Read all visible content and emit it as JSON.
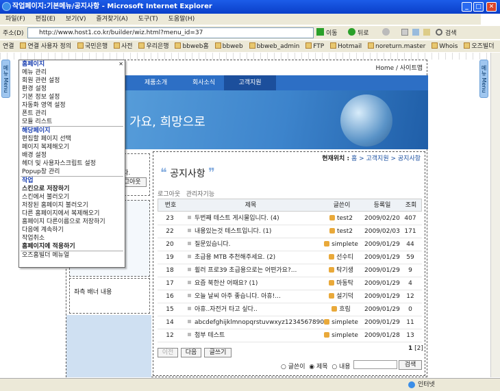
{
  "window": {
    "title": "작업페이지:기본메뉴/공지사항 - Microsoft Internet Explorer",
    "min": "_",
    "max": "□",
    "close": "✕"
  },
  "menubar": [
    "파일(F)",
    "편집(E)",
    "보기(V)",
    "즐겨찾기(A)",
    "도구(T)",
    "도움말(H)"
  ],
  "address": {
    "label": "주소(D)",
    "url": "http://www.host1.co.kr/builder/wiz.html?menu_id=37",
    "go": "이동",
    "back": "뒤로",
    "search": "검색"
  },
  "links": {
    "label": "연결",
    "items": [
      "연결 사용자 정의",
      "국민은행",
      "사전",
      "우리은행",
      "bbweb홈",
      "bbweb",
      "bbweb_admin",
      "FTP",
      "Hotmail",
      "noreturn.master",
      "Whois",
      "오즈빌더"
    ]
  },
  "page": {
    "breadcrumb_top": "Home / 사이트맵",
    "nav": [
      "제품소개",
      "회사소식",
      "고객지원"
    ],
    "banner_text": "가요, 희망으로",
    "login_text": "환영합니다.",
    "logout_btn": "로그아웃",
    "left_snippet": "기",
    "left_banner": "좌측 배너 내용",
    "location": {
      "label": "현재위치 :",
      "path": "홈 > 고객지원 > 공지사항"
    },
    "title": "공지사항",
    "admin_links": "로그아웃   관리자기능",
    "columns": [
      "번호",
      "제목",
      "글쓴이",
      "등록일",
      "조회"
    ],
    "rows": [
      {
        "no": "23",
        "title": "두번째 테스트 게시물입니다.",
        "cmt": "(4)",
        "author": "test2",
        "date": "2009/02/20",
        "views": "407"
      },
      {
        "no": "22",
        "title": "내용있는것 테스트입니다.",
        "cmt": "(1)",
        "author": "test2",
        "date": "2009/02/03",
        "views": "171"
      },
      {
        "no": "20",
        "title": "질문있습니다.",
        "cmt": "",
        "author": "simplete",
        "date": "2009/01/29",
        "views": "44"
      },
      {
        "no": "19",
        "title": "초급용 MTB 추천해주세요.",
        "cmt": "(2)",
        "author": "선수티",
        "date": "2009/01/29",
        "views": "59"
      },
      {
        "no": "18",
        "title": "휠러 프로39 초급용으로는 어떤가요?...",
        "cmt": "",
        "author": "탁기생",
        "date": "2009/01/29",
        "views": "9"
      },
      {
        "no": "17",
        "title": "요즘 북한산 어때요?",
        "cmt": "(1)",
        "author": "마동탁",
        "date": "2009/01/29",
        "views": "4"
      },
      {
        "no": "16",
        "title": "오늘 날씨 아주 좋습니다. 아휴!...",
        "cmt": "",
        "author": "설기덕",
        "date": "2009/01/29",
        "views": "12"
      },
      {
        "no": "15",
        "title": "아휴..자전거 타고 싶다..",
        "cmt": "",
        "author": "흐림",
        "date": "2009/01/29",
        "views": "0"
      },
      {
        "no": "14",
        "title": "abcdefghijklmnopqrstuvwxyz1234567890",
        "cmt": "",
        "author": "simplete",
        "date": "2009/01/29",
        "views": "11"
      },
      {
        "no": "12",
        "title": "첨부 테스트",
        "cmt": "",
        "author": "simplete",
        "date": "2009/01/28",
        "views": "13"
      }
    ],
    "pagination": "1",
    "pagination_link": "[2]",
    "buttons": {
      "prev": "이전",
      "next": "다음",
      "write": "글쓰기"
    },
    "search_opts": [
      "글쓴이",
      "제목",
      "내용"
    ],
    "search_btn": "검색"
  },
  "popup": [
    {
      "t": "홈페이지",
      "k": "sec"
    },
    {
      "t": "메뉴 관리"
    },
    {
      "t": "회원 관련 설정"
    },
    {
      "t": "환경 설정"
    },
    {
      "t": "기본 정보 설정"
    },
    {
      "t": "자동화 영역 설정"
    },
    {
      "t": "폰트 관리"
    },
    {
      "t": "모듈 리스트"
    },
    {
      "k": "sep"
    },
    {
      "t": "해당페이지",
      "k": "sec"
    },
    {
      "t": "편집할 페이지 선택"
    },
    {
      "t": "페이지 복제해오기"
    },
    {
      "t": "배경 설정"
    },
    {
      "t": "헤더 및 사용자스크립트 설정"
    },
    {
      "t": "Popup창 관리"
    },
    {
      "k": "sep"
    },
    {
      "t": "작업",
      "k": "sec"
    },
    {
      "t": "스킨으로 저장하기",
      "k": "b"
    },
    {
      "t": "스킨에서 불러오기"
    },
    {
      "t": "저장된 홈페이지 불러오기"
    },
    {
      "t": "다른 홈페이지에서 복제해오기"
    },
    {
      "t": "홈페이지 다른이름으로 저장하기"
    },
    {
      "t": "다음에 계속하기"
    },
    {
      "t": "작업취소"
    },
    {
      "t": "홈페이지에 적용하기",
      "k": "b"
    },
    {
      "k": "sep"
    },
    {
      "t": "오즈홈빌더 메뉴얼"
    }
  ],
  "side_tab": "메뉴 Menu",
  "status": {
    "zone": "인터넷"
  }
}
